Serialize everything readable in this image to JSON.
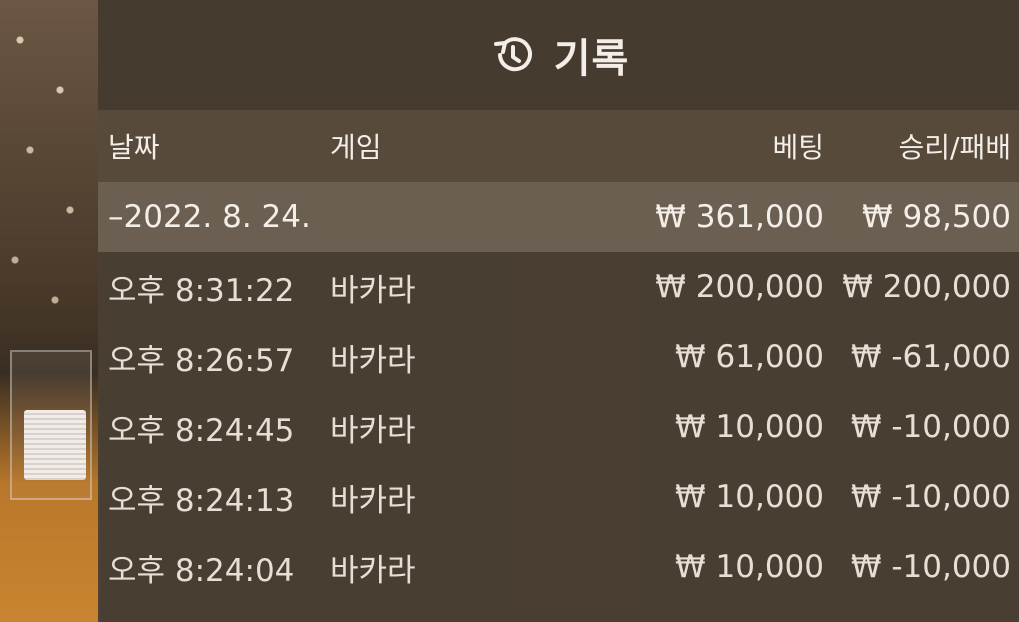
{
  "header": {
    "title": "기록",
    "icon": "history-icon"
  },
  "columns": {
    "date": "날짜",
    "game": "게임",
    "bet": "베팅",
    "result": "승리/패배"
  },
  "summary": {
    "date": "–2022. 8. 24.",
    "bet": "₩ 361,000",
    "result": "₩ 98,500"
  },
  "rows": [
    {
      "time": "오후 8:31:22",
      "game": "바카라",
      "bet": "₩ 200,000",
      "result": "₩ 200,000"
    },
    {
      "time": "오후 8:26:57",
      "game": "바카라",
      "bet": "₩ 61,000",
      "result": "₩ -61,000"
    },
    {
      "time": "오후 8:24:45",
      "game": "바카라",
      "bet": "₩ 10,000",
      "result": "₩ -10,000"
    },
    {
      "time": "오후 8:24:13",
      "game": "바카라",
      "bet": "₩ 10,000",
      "result": "₩ -10,000"
    },
    {
      "time": "오후 8:24:04",
      "game": "바카라",
      "bet": "₩ 10,000",
      "result": "₩ -10,000"
    }
  ],
  "colors": {
    "panel": "#4a3f32",
    "header": "#463b2f",
    "column_header": "#574a3b",
    "summary_row": "#6b5f51",
    "text": "#f3eee8"
  }
}
